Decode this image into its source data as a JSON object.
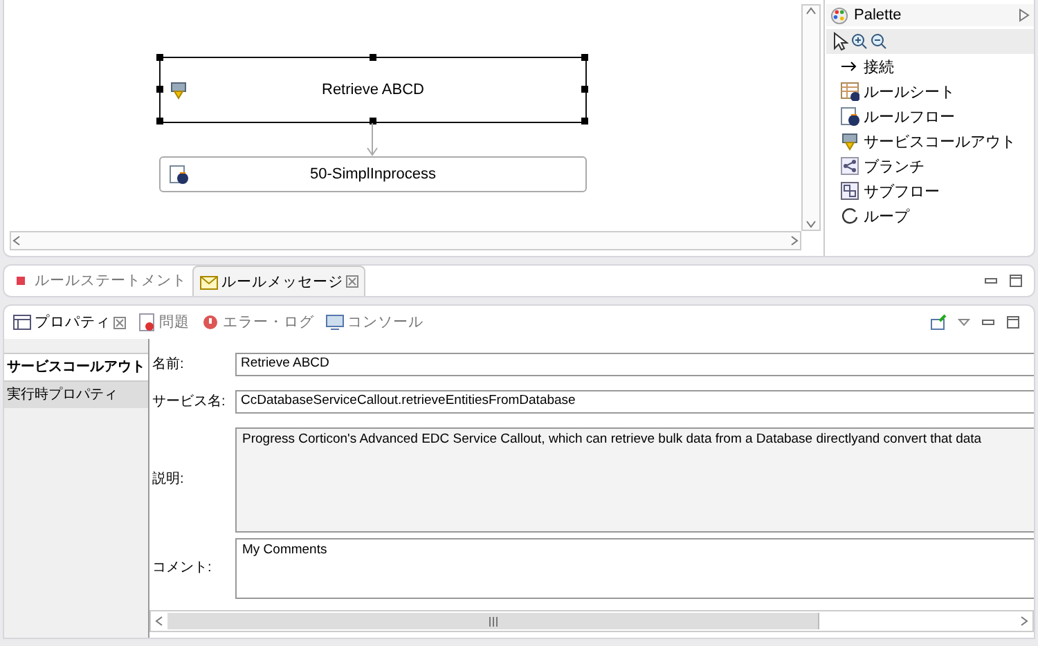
{
  "editor": {
    "nodes": [
      {
        "label": "Retrieve ABCD",
        "kind": "service-callout",
        "selected": true
      },
      {
        "label": "50-SimplInprocess",
        "kind": "ruleflow",
        "selected": false
      }
    ]
  },
  "palette": {
    "title": "Palette",
    "items": [
      {
        "label": "接続",
        "kind": "connection"
      },
      {
        "label": "ルールシート",
        "kind": "rulesheet"
      },
      {
        "label": "ルールフロー",
        "kind": "ruleflow"
      },
      {
        "label": "サービスコールアウト",
        "kind": "service-callout"
      },
      {
        "label": "ブランチ",
        "kind": "branch"
      },
      {
        "label": "サブフロー",
        "kind": "subflow"
      },
      {
        "label": "ループ",
        "kind": "loop"
      }
    ]
  },
  "view_tabs": [
    {
      "label": "ルールステートメント",
      "kind": "statement",
      "selected": false
    },
    {
      "label": "ルールメッセージ",
      "kind": "message",
      "selected": true
    }
  ],
  "properties_tabs": [
    {
      "label": "プロパティ",
      "kind": "properties",
      "selected": true
    },
    {
      "label": "問題",
      "kind": "problems",
      "selected": false
    },
    {
      "label": "エラー・ログ",
      "kind": "error-log",
      "selected": false
    },
    {
      "label": "コンソール",
      "kind": "console",
      "selected": false
    }
  ],
  "sidebar": [
    {
      "label": "サービスコールアウト",
      "selected": true
    },
    {
      "label": "実行時プロパティ",
      "selected": false
    }
  ],
  "fields": [
    {
      "label": "名前:",
      "value": "Retrieve ABCD",
      "kind": "line"
    },
    {
      "label": "サービス名:",
      "value": "CcDatabaseServiceCallout.retrieveEntitiesFromDatabase",
      "kind": "line"
    },
    {
      "label": "説明:",
      "value": "Progress Corticon's Advanced EDC Service Callout, which can retrieve bulk data from a Database directlyand convert that data",
      "kind": "readonly"
    },
    {
      "label": "コメント:",
      "value": "My Comments",
      "kind": "area"
    }
  ]
}
